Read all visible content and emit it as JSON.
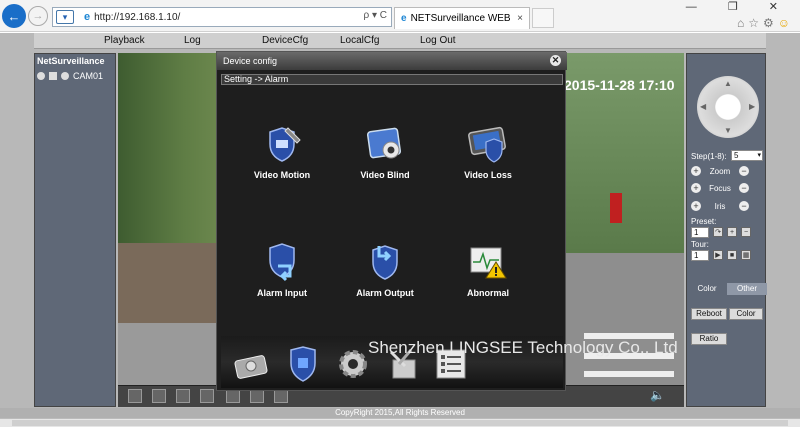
{
  "browser": {
    "url": "http://192.168.1.10/",
    "address_controls": "ρ ▾ C",
    "tab_title": "NETSurveillance WEB",
    "tab_close": "×",
    "window_controls": "— ❐ ✕",
    "back_icon": "←",
    "forward_icon": "→",
    "icons": [
      "home-icon",
      "star-icon",
      "gear-icon",
      "smiley-icon"
    ]
  },
  "menu": {
    "items": [
      "Playback",
      "Log",
      "DeviceCfg",
      "LocalCfg",
      "Log Out"
    ]
  },
  "left_panel": {
    "title": "NetSurveillance",
    "camera": "CAM01"
  },
  "video": {
    "timestamp": "2015-11-28 17:10",
    "watermark": "Shenzhen LINGSEE Technology Co., Ltd"
  },
  "dialog": {
    "title": "Device config",
    "breadcrumb": "Setting -> Alarm",
    "items": [
      {
        "label": "Video Motion",
        "icon": "video-motion-icon"
      },
      {
        "label": "Video Blind",
        "icon": "video-blind-icon"
      },
      {
        "label": "Video Loss",
        "icon": "video-loss-icon"
      },
      {
        "label": "Alarm Input",
        "icon": "alarm-input-icon"
      },
      {
        "label": "Alarm Output",
        "icon": "alarm-output-icon"
      },
      {
        "label": "Abnormal",
        "icon": "abnormal-icon"
      }
    ],
    "dock": [
      "hdd-icon",
      "alarm-shield-icon",
      "settings-gear-icon",
      "tools-icon",
      "info-list-icon"
    ]
  },
  "ptz": {
    "step_label": "Step(1-8):",
    "step_value": "5",
    "zoom": "Zoom",
    "focus": "Focus",
    "iris": "Iris",
    "preset_label": "Preset:",
    "preset_value": "1",
    "tour_label": "Tour:",
    "tour_value": "1",
    "tab_color": "Color",
    "tab_other": "Other",
    "reboot": "Reboot",
    "color_btn": "Color",
    "ratio": "Ratio",
    "plus": "+",
    "minus": "−"
  },
  "footer": {
    "copyright": "CopyRight 2015,All Rights Reserved"
  },
  "colors": {
    "accent": "#1a6ec8",
    "panel": "#5f6877",
    "dialog_bg": "#1e1e1e",
    "shield_blue": "#2a4fa8"
  }
}
